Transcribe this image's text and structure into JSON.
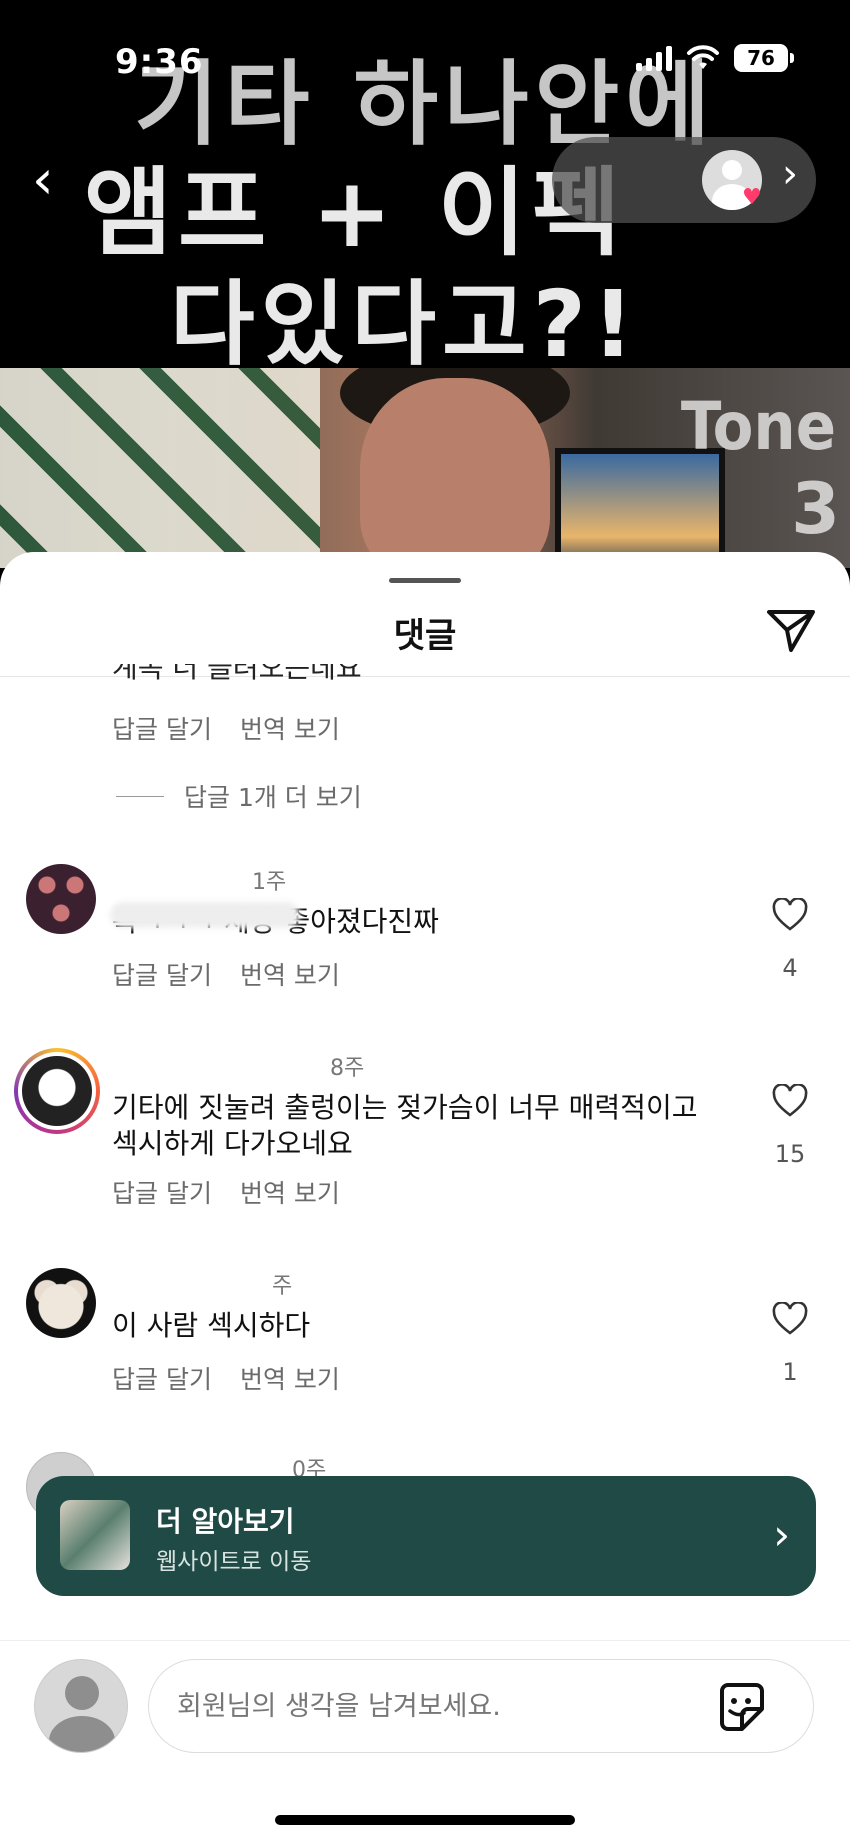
{
  "status_bar": {
    "time": "9:36",
    "battery": "76"
  },
  "video": {
    "overlay_line1": "기타 하나안에",
    "overlay_line2": "앰프 + 이펙",
    "overlay_line3": "다있다고?!",
    "corner_text": "Tone",
    "corner_number": "3"
  },
  "sheet": {
    "title": "댓글",
    "truncated_text": "계속 더 들려오는데요"
  },
  "comments": [
    {
      "reply_label": "답글 달기",
      "translate_label": "번역 보기"
    },
    {
      "time": "1주",
      "text": "옥ㅋㅋㅋ 세상 좋아졌다진짜",
      "likes": "4",
      "reply_label": "답글 달기",
      "translate_label": "번역 보기"
    },
    {
      "time": "8주",
      "text": "기타에 짓눌려 출렁이는 젖가슴이 너무 매력적이고 섹시하게 다가오네요",
      "likes": "15",
      "reply_label": "답글 달기",
      "translate_label": "번역 보기"
    },
    {
      "time": "주",
      "text": "이 사람 섹시하다",
      "likes": "1",
      "reply_label": "답글 달기",
      "translate_label": "번역 보기"
    },
    {
      "time": "0주"
    }
  ],
  "more_replies": "답글 1개 더 보기",
  "promo": {
    "title": "더 알아보기",
    "subtitle": "웹사이트로 이동"
  },
  "input": {
    "placeholder": "회원님의 생각을 남겨보세요."
  },
  "colors": {
    "promo_bg": "#1f4a45",
    "accent_heart": "#ff3b6b"
  }
}
